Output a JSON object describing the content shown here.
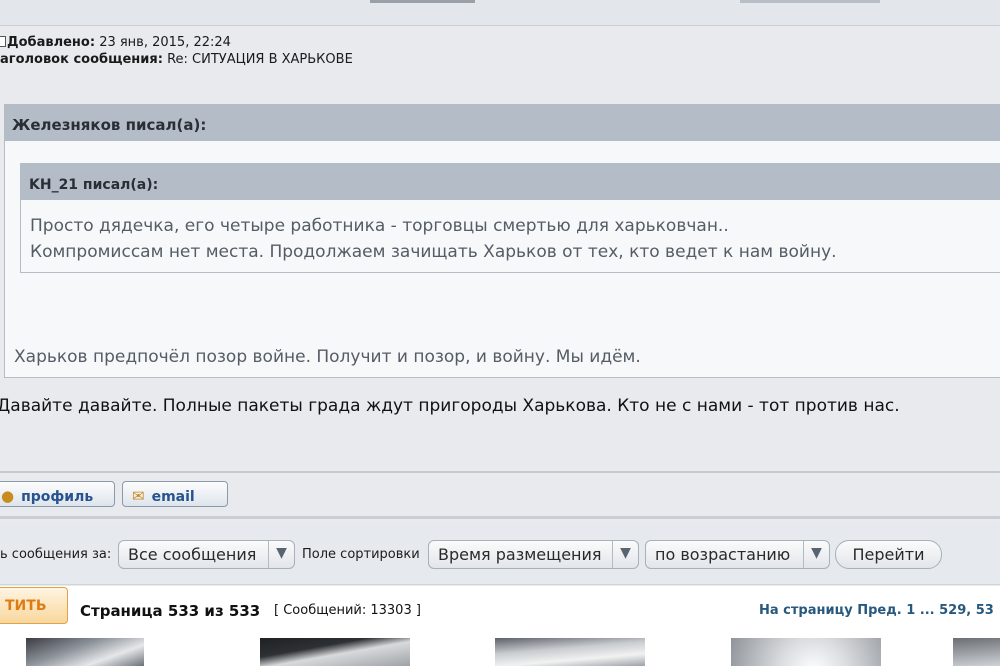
{
  "post": {
    "added_label": "Добавлено:",
    "added_value": "23 янв, 2015, 22:24",
    "subject_label": "аголовок сообщения:",
    "subject_value": "Re: СИТУАЦИЯ В ХАРЬКОВЕ"
  },
  "quote_outer": {
    "author": "Железняков писал(а):",
    "text": "Харьков предпочёл позор войне. Получит и позор, и войну. Мы идём."
  },
  "quote_inner": {
    "author": "KH_21 писал(а):",
    "line1": "Просто дядечка, его четыре работника - торговцы смертью для харьковчан..",
    "line2": "Компромиссам нет места. Продолжаем зачищать Харьков от тех, кто ведет к нам войну."
  },
  "reply_text": "Давайте давайте. Полные пакеты града ждут пригороды Харькова. Кто не с нами - тот против нас.",
  "buttons": {
    "profile": "профиль",
    "email": "email"
  },
  "sort": {
    "show_label": "ь сообщения за:",
    "show_value": "Все сообщения",
    "field_label": "Поле сортировки",
    "field_value": "Время размещения",
    "order_value": "по возрастанию",
    "go": "Перейти"
  },
  "pager": {
    "reply_button": "ТИТЬ",
    "page_title": "Страница 533 из 533",
    "message_count": "[ Сообщений: 13303 ]",
    "nav": "На страницу Пред.  1 ... 529, 53"
  }
}
